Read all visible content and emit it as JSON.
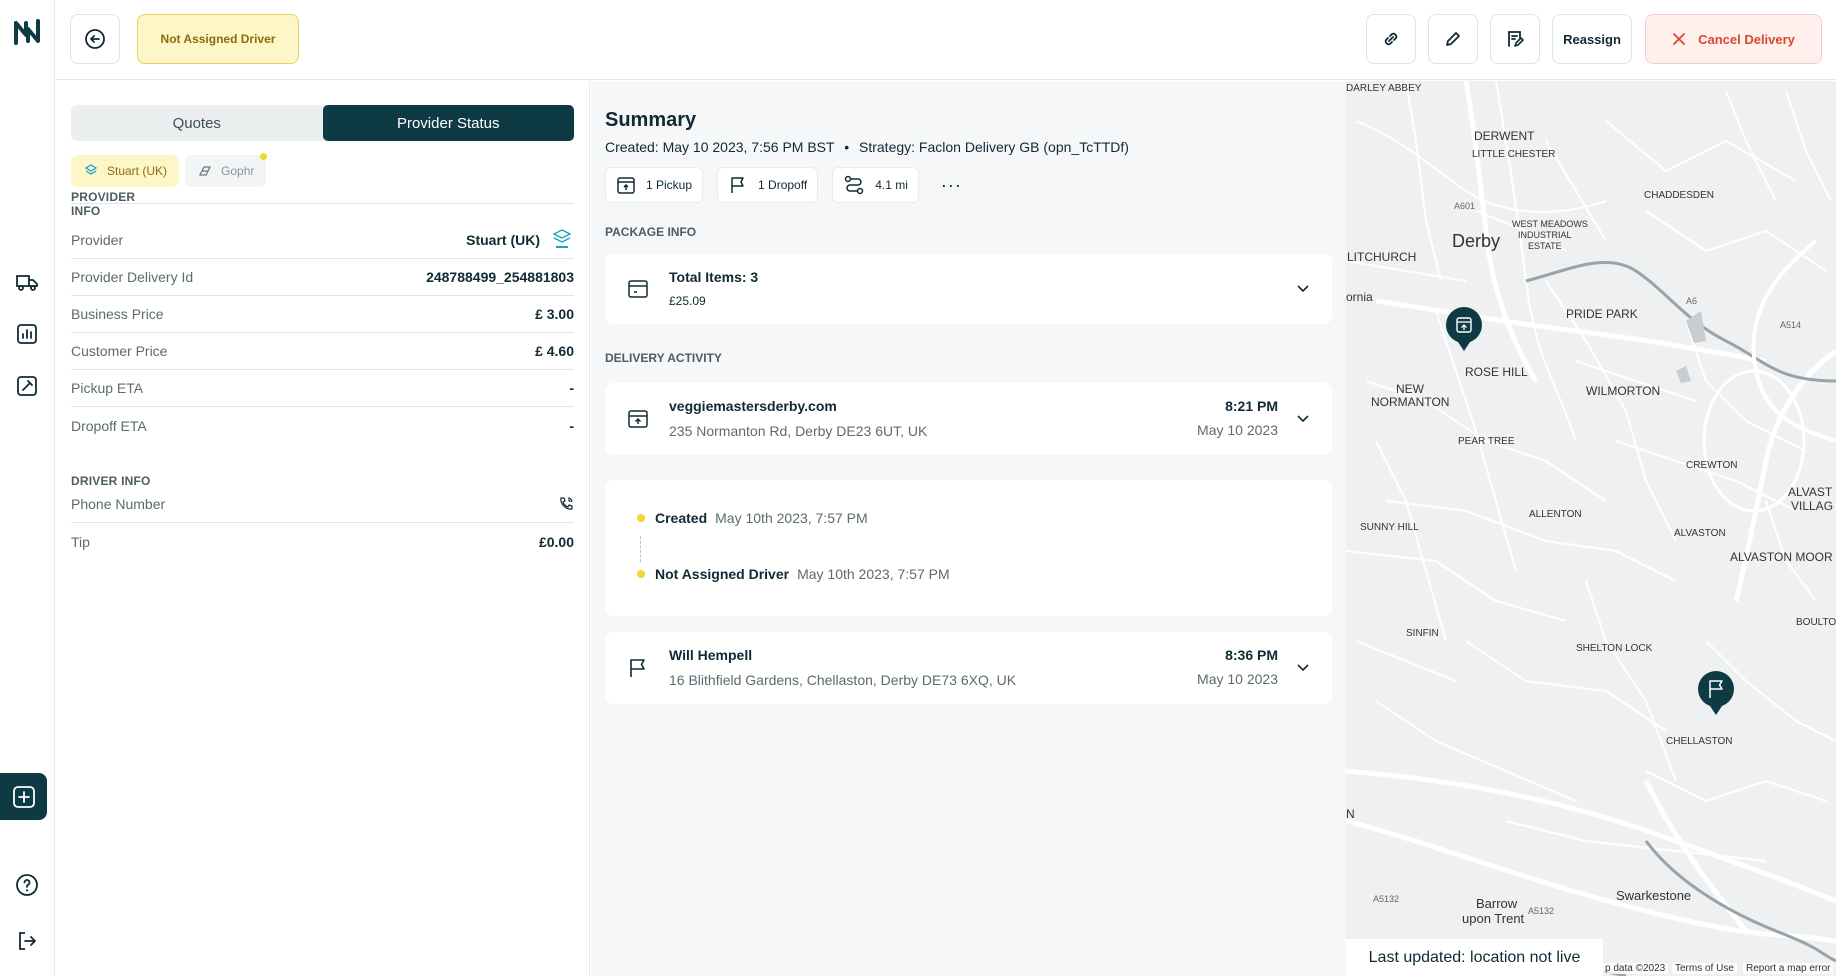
{
  "header": {
    "status_badge": "Not Assigned Driver",
    "reassign_label": "Reassign",
    "cancel_label": "Cancel Delivery"
  },
  "left": {
    "tabs": [
      "Quotes",
      "Provider Status"
    ],
    "active_tab": "Provider Status",
    "provider_tabs": [
      {
        "label": "Stuart (UK)",
        "active": true
      },
      {
        "label": "Gophr",
        "active": false
      }
    ],
    "provider_info_title": "PROVIDER INFO",
    "driver_info_title": "DRIVER INFO",
    "rows": {
      "provider": {
        "label": "Provider",
        "value": "Stuart (UK)"
      },
      "delivery_id": {
        "label": "Provider Delivery Id",
        "value": "248788499_254881803"
      },
      "business_price": {
        "label": "Business Price",
        "value": "£ 3.00"
      },
      "customer_price": {
        "label": "Customer Price",
        "value": "£ 4.60"
      },
      "pickup_eta": {
        "label": "Pickup ETA",
        "value": "-"
      },
      "dropoff_eta": {
        "label": "Dropoff ETA",
        "value": "-"
      },
      "phone": {
        "label": "Phone Number",
        "value": ""
      },
      "tip": {
        "label": "Tip",
        "value": "£0.00"
      }
    }
  },
  "summary": {
    "title": "Summary",
    "created": "Created: May 10 2023, 7:56 PM BST",
    "strategy": "Strategy: Faclon Delivery GB (opn_TcTTDf)",
    "chips": {
      "pickup": "1 Pickup",
      "dropoff": "1 Dropoff",
      "distance": "4.1 mi"
    },
    "package_title": "PACKAGE INFO",
    "package": {
      "items": "Total Items: 3",
      "price": "£25.09"
    },
    "activity_title": "DELIVERY ACTIVITY",
    "pickup": {
      "name": "veggiemastersderby.com",
      "address": "235 Normanton Rd, Derby DE23 6UT, UK",
      "time": "8:21 PM",
      "date": "May 10 2023"
    },
    "timeline": [
      {
        "label": "Created",
        "time": "May 10th 2023, 7:57 PM"
      },
      {
        "label": "Not Assigned Driver",
        "time": "May 10th 2023, 7:57 PM"
      }
    ],
    "dropoff": {
      "name": "Will Hempell",
      "address": "16 Blithfield Gardens, Chellaston, Derby DE73 6XQ, UK",
      "time": "8:36 PM",
      "date": "May 10 2023"
    }
  },
  "map": {
    "labels": {
      "darley_abbey": "DARLEY ABBEY",
      "derwent": "DERWENT",
      "little_chester": "LITTLE CHESTER",
      "chaddesden": "CHADDESDEN",
      "derby": "Derby",
      "west_meadows_1": "WEST MEADOWS",
      "west_meadows_2": "INDUSTRIAL",
      "west_meadows_3": "ESTATE",
      "litchurch": "LITCHURCH",
      "pride_park": "PRIDE PARK",
      "ornia": "ornia",
      "rose_hill": "ROSE HILL",
      "wilmorton": "WILMORTON",
      "new_normanton_1": "NEW",
      "new_normanton_2": "NORMANTON",
      "pear_tree": "PEAR TREE",
      "crewton": "CREWTON",
      "allenton": "ALLENTON",
      "sunny_hill": "SUNNY HILL",
      "alvaston": "ALVASTON",
      "alvaston_moor": "ALVASTON MOOR",
      "alvaston_village_1": "ALVAST",
      "alvaston_village_2": "VILLAG",
      "sinfin": "SINFIN",
      "shelton_lock": "SHELTON LOCK",
      "boulton": "BOULTO",
      "chellaston": "CHELLASTON",
      "n": "N",
      "barrow_1": "Barrow",
      "barrow_2": "upon Trent",
      "swarkestone": "Swarkestone",
      "a601": "A601",
      "a6": "A6",
      "a5132": "A5132",
      "a5132b": "A5132",
      "a514": "A514"
    },
    "last_updated": "Last updated: location not live",
    "map_data": "p data ©2023",
    "terms": "Terms of Use",
    "report": "Report a map error"
  }
}
